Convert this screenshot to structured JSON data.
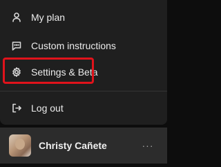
{
  "menu": {
    "items": [
      {
        "label": "My plan",
        "icon": "user-icon"
      },
      {
        "label": "Custom instructions",
        "icon": "chat-icon"
      },
      {
        "label": "Settings & Beta",
        "icon": "gear-icon"
      },
      {
        "label": "Log out",
        "icon": "logout-icon"
      }
    ]
  },
  "profile": {
    "name": "Christy Cañete",
    "more_label": "···"
  },
  "colors": {
    "highlight": "#e0131b",
    "menu_bg": "#1f1f1f",
    "profile_bg": "#2c2c2c"
  }
}
